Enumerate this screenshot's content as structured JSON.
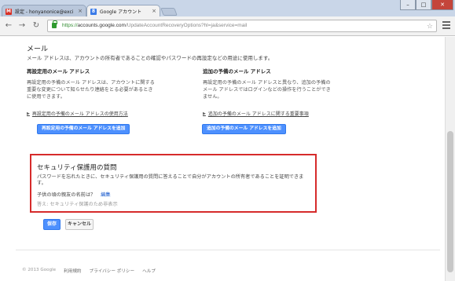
{
  "browser": {
    "tabs": [
      {
        "label": "設定 - honyanonice@exci",
        "icon": "gmail-icon",
        "active": false
      },
      {
        "label": "Google アカウント",
        "icon": "google-icon",
        "active": true
      }
    ],
    "window_controls": {
      "minimize": "–",
      "maximize": "□",
      "close": "✕"
    },
    "url": {
      "scheme": "https://",
      "host": "accounts.google.com",
      "path": "/UpdateAccountRecoveryOptions?hl=ja&service=mail"
    }
  },
  "email_section": {
    "title": "メール",
    "description": "メール アドレスは、アカウントの所有者であることの確認やパスワードの再設定などの用途に使用します。",
    "recovery": {
      "heading": "再設定用のメール アドレス",
      "body": "再設定用の予備のメール アドレスは、アカウントに関する重要な変更について知らせたり連絡をとる必要があるときに使用できます。",
      "link": "再設定用の予備のメール アドレスの使用方法",
      "button": "再設定用の予備のメール アドレスを追加"
    },
    "additional": {
      "heading": "追加の予備のメール アドレス",
      "body": "再設定用の予備のメール アドレスと異なり、追加の予備のメール アドレスではログインなどの操作を行うことができません。",
      "link": "追加の予備のメール アドレスに関する重要事項",
      "button": "追加の予備のメール アドレスを追加"
    }
  },
  "security_question": {
    "title": "セキュリティ保護用の質問",
    "description": "パスワードを忘れたときに、セキュリティ保護用の質問に答えることで自分がアカウントの所有者であることを証明できます。",
    "question": "子供の頃の親友の名前は？",
    "edit_label": "編集",
    "answer": "答え: セキュリティ保護のため非表示"
  },
  "actions": {
    "save": "保存",
    "cancel": "キャンセル"
  },
  "footer": {
    "copyright": "© 2013 Google",
    "links": [
      "利用規約",
      "プライバシー ポリシー",
      "ヘルプ"
    ]
  }
}
